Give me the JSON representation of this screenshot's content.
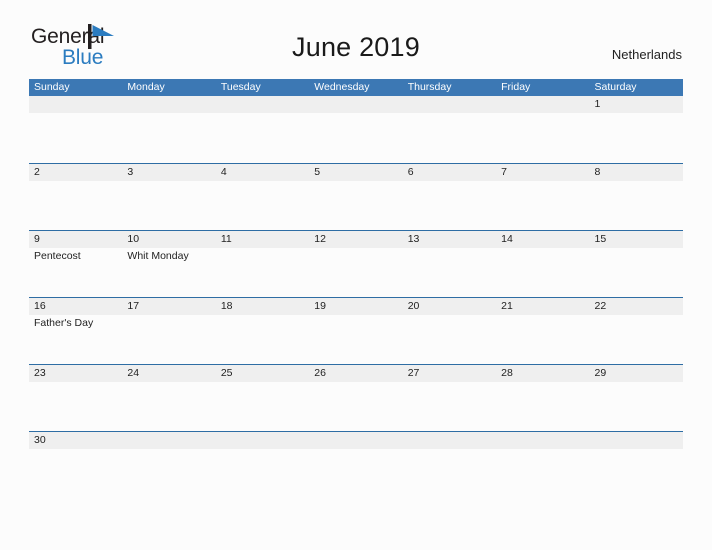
{
  "brand": {
    "name_part1": "General",
    "name_part2": "Blue",
    "flag_icon": "blue-flag-triangle"
  },
  "header": {
    "title": "June 2019",
    "country": "Netherlands"
  },
  "colors": {
    "header_blue": "#3c78b4",
    "row_line_blue": "#2e6da4",
    "number_band_gray": "#efefef",
    "brand_blue": "#2b7cc0",
    "page_background": "#fcfcfc",
    "text": "#222222"
  },
  "calendar": {
    "weekdays": [
      "Sunday",
      "Monday",
      "Tuesday",
      "Wednesday",
      "Thursday",
      "Friday",
      "Saturday"
    ],
    "weeks": [
      [
        {
          "day": "",
          "events": []
        },
        {
          "day": "",
          "events": []
        },
        {
          "day": "",
          "events": []
        },
        {
          "day": "",
          "events": []
        },
        {
          "day": "",
          "events": []
        },
        {
          "day": "",
          "events": []
        },
        {
          "day": "1",
          "events": []
        }
      ],
      [
        {
          "day": "2",
          "events": []
        },
        {
          "day": "3",
          "events": []
        },
        {
          "day": "4",
          "events": []
        },
        {
          "day": "5",
          "events": []
        },
        {
          "day": "6",
          "events": []
        },
        {
          "day": "7",
          "events": []
        },
        {
          "day": "8",
          "events": []
        }
      ],
      [
        {
          "day": "9",
          "events": [
            "Pentecost"
          ]
        },
        {
          "day": "10",
          "events": [
            "Whit Monday"
          ]
        },
        {
          "day": "11",
          "events": []
        },
        {
          "day": "12",
          "events": []
        },
        {
          "day": "13",
          "events": []
        },
        {
          "day": "14",
          "events": []
        },
        {
          "day": "15",
          "events": []
        }
      ],
      [
        {
          "day": "16",
          "events": [
            "Father's Day"
          ]
        },
        {
          "day": "17",
          "events": []
        },
        {
          "day": "18",
          "events": []
        },
        {
          "day": "19",
          "events": []
        },
        {
          "day": "20",
          "events": []
        },
        {
          "day": "21",
          "events": []
        },
        {
          "day": "22",
          "events": []
        }
      ],
      [
        {
          "day": "23",
          "events": []
        },
        {
          "day": "24",
          "events": []
        },
        {
          "day": "25",
          "events": []
        },
        {
          "day": "26",
          "events": []
        },
        {
          "day": "27",
          "events": []
        },
        {
          "day": "28",
          "events": []
        },
        {
          "day": "29",
          "events": []
        }
      ],
      [
        {
          "day": "30",
          "events": []
        },
        {
          "day": "",
          "events": []
        },
        {
          "day": "",
          "events": []
        },
        {
          "day": "",
          "events": []
        },
        {
          "day": "",
          "events": []
        },
        {
          "day": "",
          "events": []
        },
        {
          "day": "",
          "events": []
        }
      ]
    ]
  }
}
